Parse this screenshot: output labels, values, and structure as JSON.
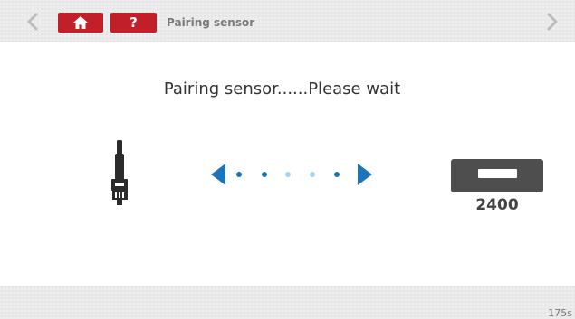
{
  "header": {
    "title": "Pairing sensor",
    "back_icon": "chevron-left-icon",
    "forward_icon": "chevron-right-icon",
    "home_icon": "home-icon",
    "help_label": "?",
    "accent_color": "#c1202a"
  },
  "main": {
    "status_text": "Pairing sensor......Please wait",
    "sensor_icon": "tpms-sensor-icon",
    "progress": {
      "left_arrow_icon": "arrow-left-icon",
      "right_arrow_icon": "arrow-right-icon",
      "dots_active": [
        true,
        true,
        false,
        false,
        true
      ],
      "active_color": "#1e74b8",
      "inactive_color": "#a6d4ef"
    },
    "device_icon": "receiver-device-icon",
    "device_value": "2400"
  },
  "footer": {
    "timer": "175s"
  }
}
